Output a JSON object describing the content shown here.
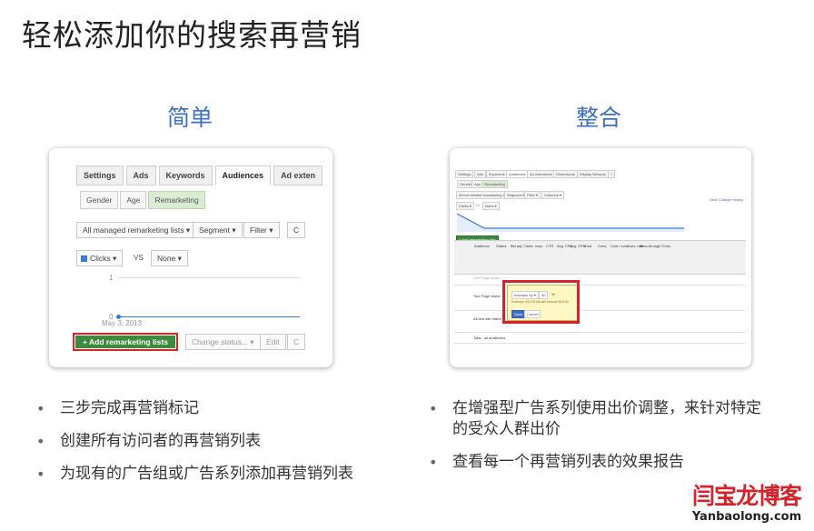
{
  "title": "轻松添加你的搜索再营销",
  "left": {
    "heading": "简单",
    "screenshot": {
      "tabs": [
        "Settings",
        "Ads",
        "Keywords",
        "Audiences",
        "Ad exten"
      ],
      "active_tab": "Audiences",
      "subtabs": [
        "Gender",
        "Age",
        "Remarketing"
      ],
      "active_subtab": "Remarketing",
      "filters": [
        "All managed remarketing lists ▾",
        "Segment ▾",
        "Filter ▾",
        "C"
      ],
      "metric1": "Clicks ▾",
      "vs": "VS",
      "metric2": "None ▾",
      "axis_top": "1",
      "axis_bottom": "0",
      "date": "May 3, 2013",
      "add_button": "+ Add remarketing lists",
      "change_status": "Change status... ▾",
      "edit": "Edit",
      "more": "C"
    },
    "bullets": [
      "三步完成再营销标记",
      "创建所有访问者的再营销列表",
      "为现有的广告组或广告系列添加再营销列表"
    ]
  },
  "right": {
    "heading": "整合",
    "screenshot": {
      "tabs": [
        "Settings",
        "Ads",
        "Keywords",
        "Audiences",
        "Ad extensions",
        "Dimensions",
        "Display Network",
        "+"
      ],
      "subtabs": [
        "Gender",
        "Age",
        "Remarketing"
      ],
      "filters": [
        "All but deleted remarketing lists ▾",
        "Segment ▾",
        "Filter ▾",
        "Columns ▾"
      ],
      "view_link": "View Change History",
      "metric": "Clicks ▾",
      "vs": "VS",
      "none": "None ▾",
      "add_button": "+ Add remarketing lists",
      "columns": [
        "Audience",
        "Status",
        "Bid adj.",
        "Clicks",
        "Impr.",
        "CTR",
        "Avg. CPC",
        "Avg. CPM",
        "Cost",
        "Conv.",
        "Cost / conv.",
        "Conv. rate",
        "View-through Conv."
      ],
      "rows": [
        "Cart Page visitor",
        "Tour Page visitor",
        "All test site visitor",
        "Total - all audiences"
      ],
      "popup_select": "Increase by ▾",
      "popup_value": "30",
      "popup_pct": "%",
      "popup_note": "Example: $10.00 bid will become $13.00",
      "popup_save": "Save",
      "popup_cancel": "Cancel"
    },
    "bullets": [
      "在增强型广告系列使用出价调整，来针对特定的受众人群出价",
      "查看每一个再营销列表的效果报告"
    ]
  },
  "logo": {
    "cn": "闫宝龙博客",
    "en": "Yanbaolong.com"
  },
  "colors": {
    "accent_blue": "#3b6fc8",
    "logo_red": "#d6222b",
    "button_green": "#3c8a3c"
  }
}
